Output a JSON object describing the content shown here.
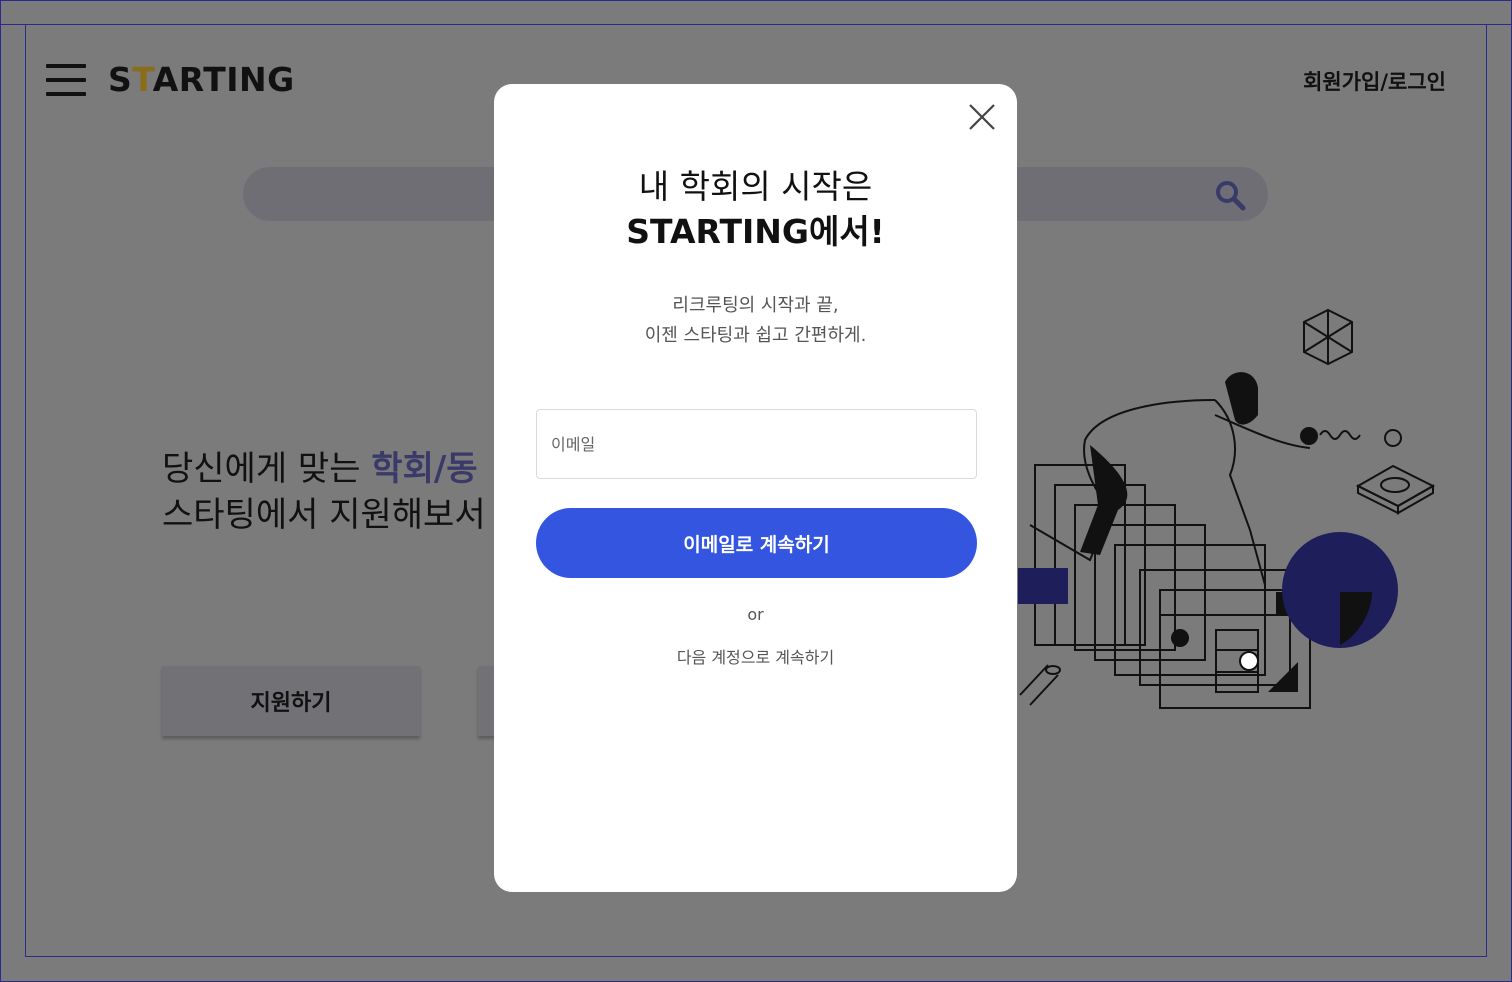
{
  "header": {
    "logo": {
      "prefix": "S",
      "accent": "T",
      "rest": "ARTING"
    },
    "auth_link": "회원가입/로그인"
  },
  "hero": {
    "line1_prefix": "당신에게 맞는 ",
    "line1_highlight": "학회/동",
    "line2": "스타팅에서 지원해보서"
  },
  "buttons": {
    "apply_label": "지원하기"
  },
  "modal": {
    "title_line1": "내 학회의 시작은",
    "title_line2_bold": "STARTING",
    "title_line2_rest": "에서!",
    "sub_line1": "리크루팅의 시작과 끝,",
    "sub_line2": "이젠 스타팅과 쉽고 간편하게.",
    "email_placeholder": "이메일",
    "email_button": "이메일로 계속하기",
    "or_text": "or",
    "social_label": "다음 계정으로 계속하기"
  },
  "colors": {
    "primary": "#3355e0",
    "overlay": "#7b7b7b",
    "logo_accent": "#8a6d1a"
  },
  "icons": [
    "hamburger-icon",
    "search-icon",
    "close-icon"
  ]
}
